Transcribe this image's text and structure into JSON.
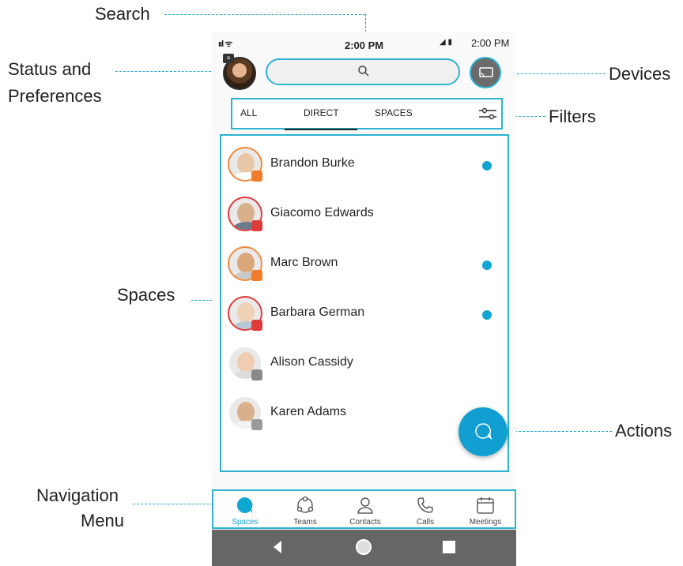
{
  "callouts": {
    "search": "Search",
    "status_line1": "Status and",
    "status_line2": "Preferences",
    "devices": "Devices",
    "filters": "Filters",
    "spaces": "Spaces",
    "actions": "Actions",
    "navigation_line1": "Navigation",
    "navigation_line2": "Menu"
  },
  "statusbar": {
    "signal": "ııl ᯤ",
    "time": "2:00 PM",
    "time_right": "2:00 PM"
  },
  "filters": {
    "tabs": [
      "ALL",
      "DIRECT",
      "SPACES"
    ],
    "selected": "DIRECT"
  },
  "spaces": [
    {
      "name": "Brandon Burke",
      "unread": true,
      "badge_color": "#f07c2a",
      "ring_color": "#f08a3c",
      "skin": "#e8c7a6",
      "shirt": "#ffffff"
    },
    {
      "name": "Giacomo Edwards",
      "unread": false,
      "badge_color": "#e03b3b",
      "ring_color": "#e03b3b",
      "skin": "#d9b08c",
      "shirt": "#6b7c8a"
    },
    {
      "name": "Marc Brown",
      "unread": true,
      "badge_color": "#f07c2a",
      "ring_color": "#f08a3c",
      "skin": "#d9a77a",
      "shirt": "#c9c9c9"
    },
    {
      "name": "Barbara German",
      "unread": true,
      "badge_color": "#e03b3b",
      "ring_color": "#e03b3b",
      "skin": "#efd2b6",
      "shirt": "#b9c7d6"
    },
    {
      "name": "Alison Cassidy",
      "unread": false,
      "badge_color": "#8a8a8a",
      "ring_color": "#ffffff",
      "skin": "#f0cdb0",
      "shirt": "#dcdcdc"
    },
    {
      "name": "Karen Adams",
      "unread": true,
      "badge_color": "#9a9a9a",
      "ring_color": "#ffffff",
      "skin": "#d9b08c",
      "shirt": "#f2f2f2"
    }
  ],
  "nav": [
    {
      "label": "Spaces",
      "icon": "spaces-icon",
      "active": true
    },
    {
      "label": "Teams",
      "icon": "teams-icon",
      "active": false
    },
    {
      "label": "Contacts",
      "icon": "contacts-icon",
      "active": false
    },
    {
      "label": "Calls",
      "icon": "calls-icon",
      "active": false
    },
    {
      "label": "Meetings",
      "icon": "meetings-icon",
      "active": false
    }
  ],
  "colors": {
    "accent": "#2bb3d1",
    "unread_dot": "#10a6d3",
    "fab": "#119fd1",
    "android_nav": "#666666"
  }
}
